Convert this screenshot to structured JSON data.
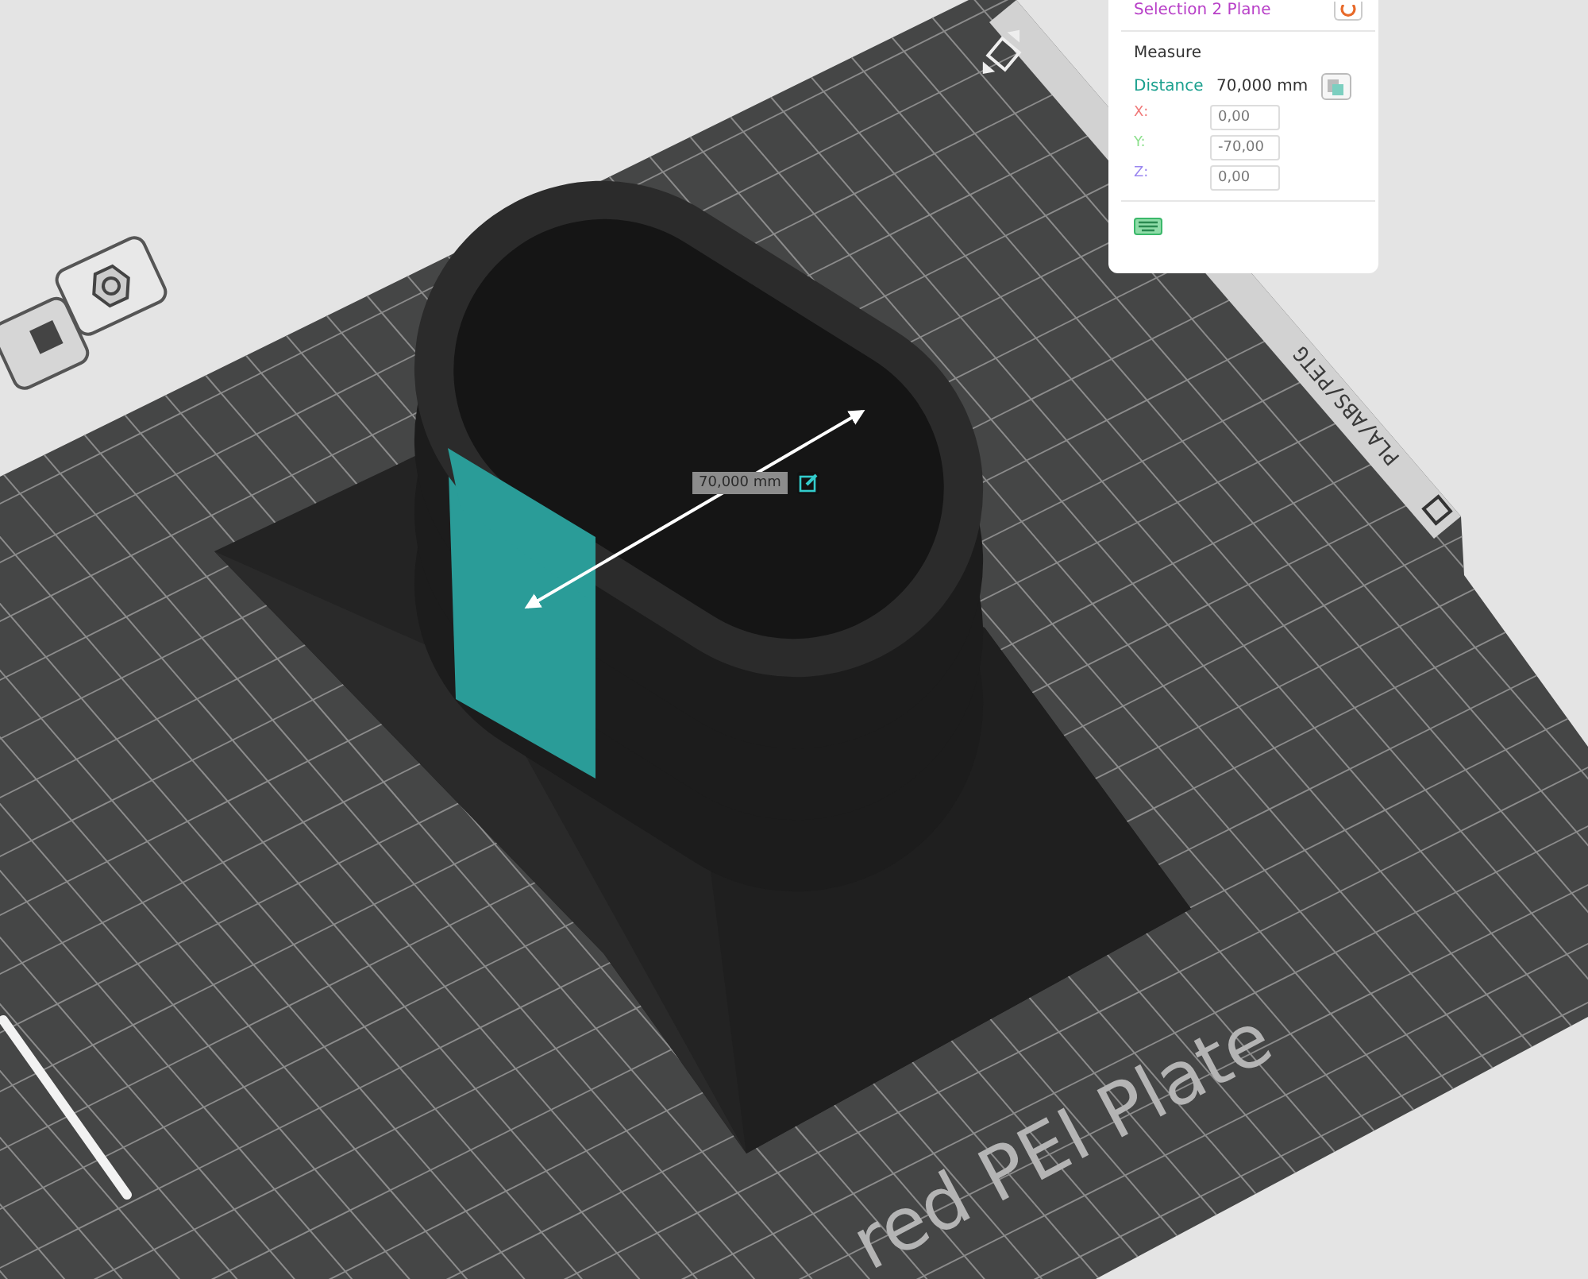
{
  "viewport": {
    "plate_labels": [
      {
        "kind": "plate-name",
        "text": "red PEI Plate"
      },
      {
        "kind": "filament",
        "text": "PLA/ABS/PETG"
      }
    ],
    "measurement_label": "70,000 mm"
  },
  "measure_panel": {
    "selection": "Selection 2  Plane",
    "title": "Measure",
    "distance": {
      "label": "Distance",
      "value": "70,000 mm"
    },
    "axes": [
      {
        "label": "X:",
        "value": "0,00",
        "color": "#f07a7a"
      },
      {
        "label": "Y:",
        "value": "-70,00",
        "color": "#8ee08e"
      },
      {
        "label": "Z:",
        "value": "0,00",
        "color": "#9a86f0"
      }
    ]
  }
}
